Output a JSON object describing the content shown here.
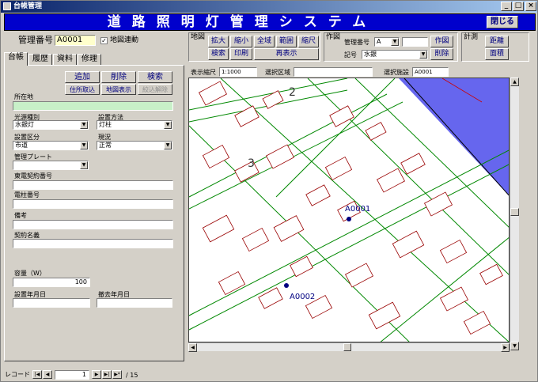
{
  "window": {
    "title": "台帳管理",
    "minimize": "_",
    "maximize": "□",
    "close": "×"
  },
  "banner": {
    "title": "道路照明灯管理システム",
    "close_button": "閉じる"
  },
  "header": {
    "id_label": "管理番号",
    "id_value": "A0001",
    "map_link_label": "地図連動",
    "map_link_checked": "✓"
  },
  "map_group": {
    "label": "地図",
    "zoom_in": "拡大",
    "zoom_out": "縮小",
    "full": "全域",
    "range": "範囲",
    "scale": "縮尺",
    "search": "検索",
    "print": "印刷",
    "redraw": "再表示"
  },
  "draw_group": {
    "label": "作図",
    "id_label": "管理番号",
    "id_value": "A",
    "id_extra": "",
    "draw": "作図",
    "symbol_label": "記号",
    "symbol_value": "水銀",
    "delete": "削除"
  },
  "measure_group": {
    "label": "計測",
    "distance": "距離",
    "area": "面積"
  },
  "tabs": [
    "台帳",
    "履歴",
    "資料",
    "修理"
  ],
  "actions": {
    "add": "追加",
    "delete": "削除",
    "search": "検索",
    "address": "住所取込",
    "map_show": "地図表示",
    "narrow_off": "絞込解除"
  },
  "form": {
    "location_label": "所在地",
    "location_value": "",
    "light_type_label": "光源種別",
    "light_type_value": "水銀灯",
    "install_method_label": "設置方法",
    "install_method_value": "灯柱",
    "install_class_label": "設置区分",
    "install_class_value": "市道",
    "status_label": "現況",
    "status_value": "正常",
    "plate_label": "管理プレート",
    "plate_value": "",
    "contract_label": "東電契約番号",
    "contract_value": "",
    "pole_label": "電柱番号",
    "pole_value": "",
    "note_label": "備考",
    "note_value": "",
    "contract_name_label": "契約名義",
    "contract_name_value": "",
    "capacity_label": "容量（W）",
    "capacity_value": "100",
    "install_date_label": "設置年月日",
    "install_date_value": "",
    "removal_date_label": "撤去年月日",
    "removal_date_value": ""
  },
  "map_info": {
    "scale_label": "表示縮尺",
    "scale_value": "1:1000",
    "area_label": "選択区域",
    "area_value": "",
    "facility_label": "選択施設",
    "facility_value": "A0001",
    "markers": [
      "A0001",
      "A0002"
    ],
    "block_labels": [
      "2",
      "3"
    ]
  },
  "colors": {
    "banner": "#0000cc",
    "water": "#6666ee",
    "building": "#990000",
    "road": "#008800",
    "marker": "#000080"
  },
  "record_nav": {
    "label": "レコード",
    "current": "1",
    "total": "/ 15"
  }
}
